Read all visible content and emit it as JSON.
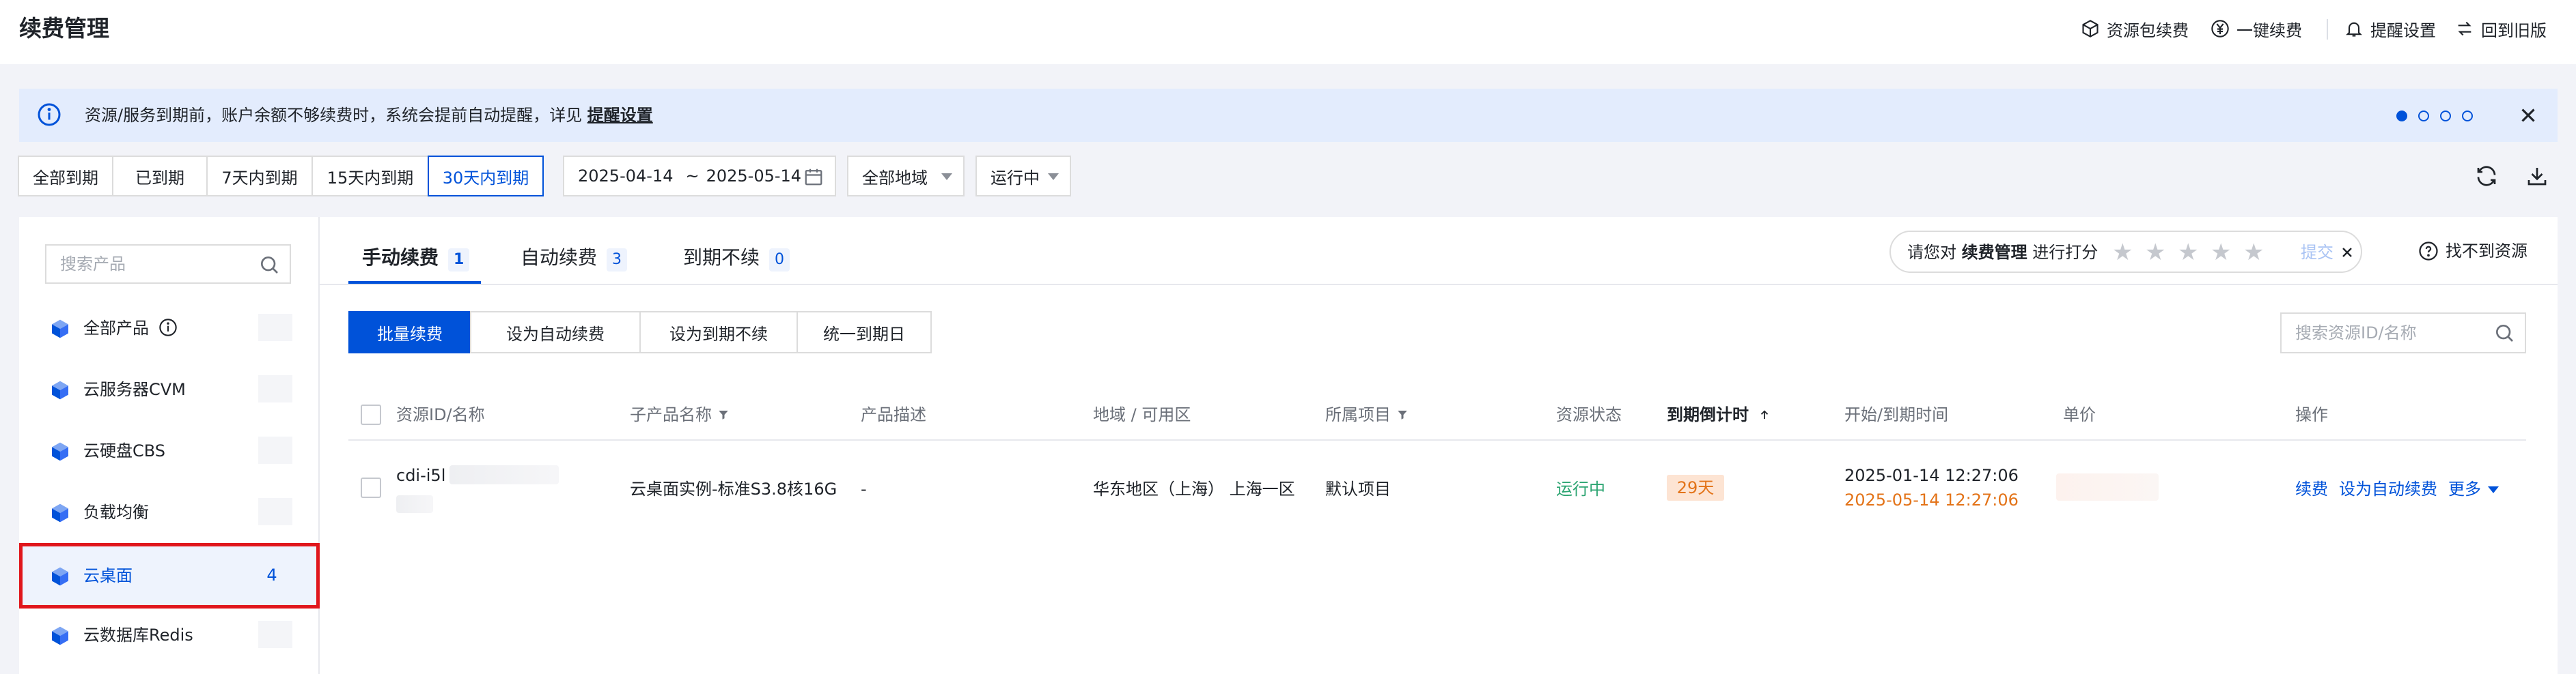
{
  "header": {
    "title": "续费管理",
    "actions": [
      {
        "label": "资源包续费",
        "icon": "package-icon"
      },
      {
        "label": "一键续费",
        "icon": "yen-circle-icon"
      },
      {
        "label": "提醒设置",
        "icon": "bell-icon"
      },
      {
        "label": "回到旧版",
        "icon": "swap-icon"
      }
    ]
  },
  "banner": {
    "text": "资源/服务到期前，账户余额不够续费时，系统会提前自动提醒，详见",
    "link": "提醒设置",
    "pages": 4,
    "active_page": 1
  },
  "filters": {
    "expiry_tabs": [
      "全部到期",
      "已到期",
      "7天内到期",
      "15天内到期",
      "30天内到期"
    ],
    "active_expiry_tab": "30天内到期",
    "date_start": "2025-04-14",
    "date_sep": "~",
    "date_end": "2025-05-14",
    "region": "全部地域",
    "status": "运行中"
  },
  "sidebar": {
    "search_placeholder": "搜索产品",
    "items": [
      {
        "label": "全部产品",
        "count": ""
      },
      {
        "label": "云服务器CVM",
        "count": ""
      },
      {
        "label": "云硬盘CBS",
        "count": ""
      },
      {
        "label": "负载均衡",
        "count": ""
      },
      {
        "label": "云桌面",
        "count": "4"
      },
      {
        "label": "云数据库Redis",
        "count": ""
      }
    ],
    "selected": "云桌面"
  },
  "main": {
    "tabs": [
      {
        "label": "手动续费",
        "count": "1"
      },
      {
        "label": "自动续费",
        "count": "3"
      },
      {
        "label": "到期不续",
        "count": "0"
      }
    ],
    "active_tab": "手动续费",
    "rating": {
      "prefix": "请您对",
      "subject": "续费管理",
      "suffix": "进行打分",
      "stars": 5,
      "submit": "提交"
    },
    "help_label": "找不到资源",
    "buttons": [
      "批量续费",
      "设为自动续费",
      "设为到期不续",
      "统一到期日"
    ],
    "resource_search_placeholder": "搜索资源ID/名称",
    "table": {
      "columns": [
        "资源ID/名称",
        "子产品名称",
        "产品描述",
        "地域 / 可用区",
        "所属项目",
        "资源状态",
        "到期倒计时",
        "开始/到期时间",
        "单价",
        "操作"
      ],
      "rows": [
        {
          "id": "cdi-i5l",
          "sub_product": "云桌面实例-标准S3.8核16G",
          "description": "-",
          "region": "华东地区（上海）",
          "zone": "上海一区",
          "project": "默认项目",
          "status": "运行中",
          "countdown": "29天",
          "start_time": "2025-01-14 12:27:06",
          "end_time": "2025-05-14 12:27:06",
          "actions": [
            "续费",
            "设为自动续费",
            "更多"
          ]
        }
      ]
    }
  },
  "colors": {
    "primary": "#0052d9",
    "success": "#2ba471",
    "warning": "#e37318",
    "highlight_border": "#e0161c"
  }
}
